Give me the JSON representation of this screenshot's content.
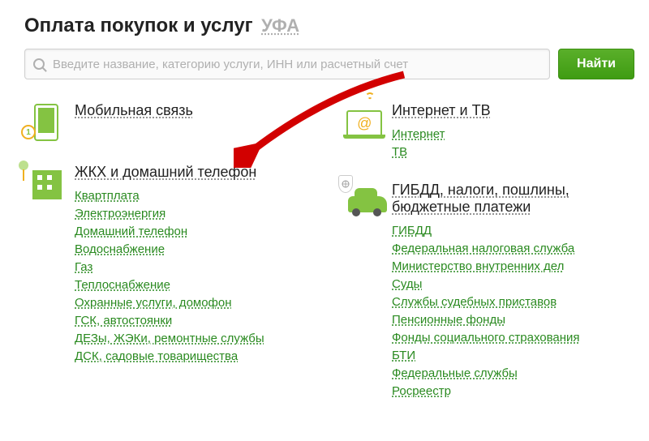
{
  "header": {
    "title": "Оплата покупок и услуг",
    "city": "УФА"
  },
  "search": {
    "placeholder": "Введите название, категорию услуги, ИНН или расчетный счет",
    "button": "Найти"
  },
  "left": [
    {
      "title": "Мобильная связь",
      "icon": "mobile",
      "links": []
    },
    {
      "title": "ЖКХ и домашний телефон",
      "icon": "house",
      "links": [
        "Квартплата",
        "Электроэнергия",
        "Домашний телефон",
        "Водоснабжение",
        "Газ",
        "Теплоснабжение",
        "Охранные услуги, домофон",
        "ГСК, автостоянки",
        "ДЕЗы, ЖЭКи, ремонтные службы",
        "ДСК, садовые товарищества"
      ]
    }
  ],
  "right": [
    {
      "title": "Интернет и ТВ",
      "icon": "laptop",
      "links": [
        "Интернет",
        "ТВ"
      ]
    },
    {
      "title": "ГИБДД, налоги, пошлины, бюджетные платежи",
      "icon": "car",
      "links": [
        "ГИБДД",
        "Федеральная налоговая служба",
        "Министерство внутренних дел",
        "Суды",
        "Службы судебных приставов",
        "Пенсионные фонды",
        "Фонды социального страхования",
        "БТИ",
        "Федеральные службы",
        "Росреестр"
      ]
    }
  ],
  "phone_badge": "1"
}
